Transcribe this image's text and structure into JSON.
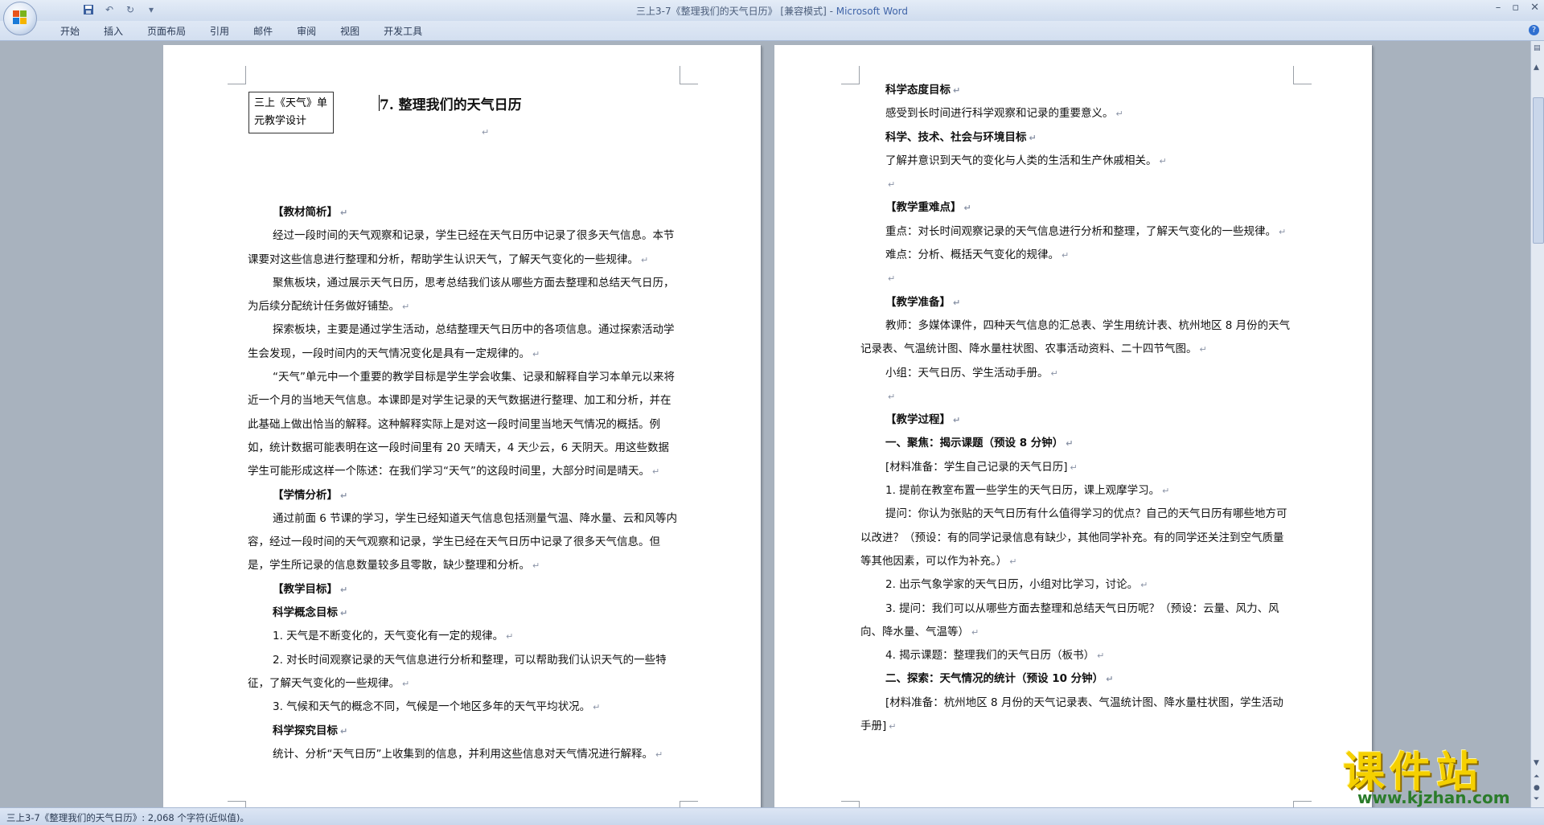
{
  "window": {
    "title_doc": "三上3-7《整理我们的天气日历》 [兼容模式] - ",
    "title_app": "Microsoft Word"
  },
  "ribbon": {
    "tabs": [
      "开始",
      "插入",
      "页面布局",
      "引用",
      "邮件",
      "审阅",
      "视图",
      "开发工具"
    ]
  },
  "page1": {
    "unit_box": "三上《天气》单元教学设计",
    "title": "7. 整理我们的天气日历",
    "paragraphs": [
      "【教材简析】",
      "经过一段时间的天气观察和记录，学生已经在天气日历中记录了很多天气信息。本节课要对这些信息进行整理和分析，帮助学生认识天气，了解天气变化的一些规律。",
      "聚焦板块，通过展示天气日历，思考总结我们该从哪些方面去整理和总结天气日历，为后续分配统计任务做好铺垫。",
      "探索板块，主要是通过学生活动，总结整理天气日历中的各项信息。通过探索活动学生会发现，一段时间内的天气情况变化是具有一定规律的。",
      "“天气”单元中一个重要的教学目标是学生学会收集、记录和解释自学习本单元以来将近一个月的当地天气信息。本课即是对学生记录的天气数据进行整理、加工和分析，并在此基础上做出恰当的解释。这种解释实际上是对这一段时间里当地天气情况的概括。例如，统计数据可能表明在这一段时间里有 20 天晴天，4 天少云，6 天阴天。用这些数据学生可能形成这样一个陈述：在我们学习“天气”的这段时间里，大部分时间是晴天。",
      "【学情分析】",
      "通过前面 6 节课的学习，学生已经知道天气信息包括测量气温、降水量、云和风等内容，经过一段时间的天气观察和记录，学生已经在天气日历中记录了很多天气信息。但是，学生所记录的信息数量较多且零散，缺少整理和分析。",
      "【教学目标】",
      "科学概念目标",
      "1. 天气是不断变化的，天气变化有一定的规律。",
      "2. 对长时间观察记录的天气信息进行分析和整理，可以帮助我们认识天气的一些特征，了解天气变化的一些规律。",
      "3. 气候和天气的概念不同，气候是一个地区多年的天气平均状况。",
      "科学探究目标",
      "统计、分析“天气日历”上收集到的信息，并利用这些信息对天气情况进行解释。"
    ]
  },
  "page2": {
    "paragraphs": [
      "科学态度目标",
      "感受到长时间进行科学观察和记录的重要意义。",
      "科学、技术、社会与环境目标",
      "了解并意识到天气的变化与人类的生活和生产休戚相关。",
      "",
      "【教学重难点】",
      "重点：对长时间观察记录的天气信息进行分析和整理，了解天气变化的一些规律。",
      "难点：分析、概括天气变化的规律。",
      "",
      "【教学准备】",
      "教师：多媒体课件，四种天气信息的汇总表、学生用统计表、杭州地区 8 月份的天气记录表、气温统计图、降水量柱状图、农事活动资料、二十四节气图。",
      "小组：天气日历、学生活动手册。",
      "",
      "【教学过程】",
      "一、聚焦：揭示课题（预设 8 分钟）",
      "[材料准备：学生自己记录的天气日历]",
      "1. 提前在教室布置一些学生的天气日历，课上观摩学习。",
      "提问：你认为张贴的天气日历有什么值得学习的优点？自己的天气日历有哪些地方可以改进？（预设：有的同学记录信息有缺少，其他同学补充。有的同学还关注到空气质量等其他因素，可以作为补充。）",
      "2. 出示气象学家的天气日历，小组对比学习，讨论。",
      "3. 提问：我们可以从哪些方面去整理和总结天气日历呢？（预设：云量、风力、风向、降水量、气温等）",
      "4. 揭示课题：整理我们的天气日历（板书）",
      "二、探索：天气情况的统计（预设 10 分钟）",
      "[材料准备：杭州地区 8 月份的天气记录表、气温统计图、降水量柱状图，学生活动手册]"
    ]
  },
  "status": {
    "text": "三上3-7《整理我们的天气日历》: 2,068 个字符(近似值)。"
  },
  "watermark": {
    "cn": "课件站",
    "url": "www.kjzhan.com"
  },
  "colors": {
    "app_title": "#3f64a8",
    "workspace": "#a8b2be",
    "watermark_yellow": "#f5d000",
    "watermark_green": "#2b7c2b"
  }
}
